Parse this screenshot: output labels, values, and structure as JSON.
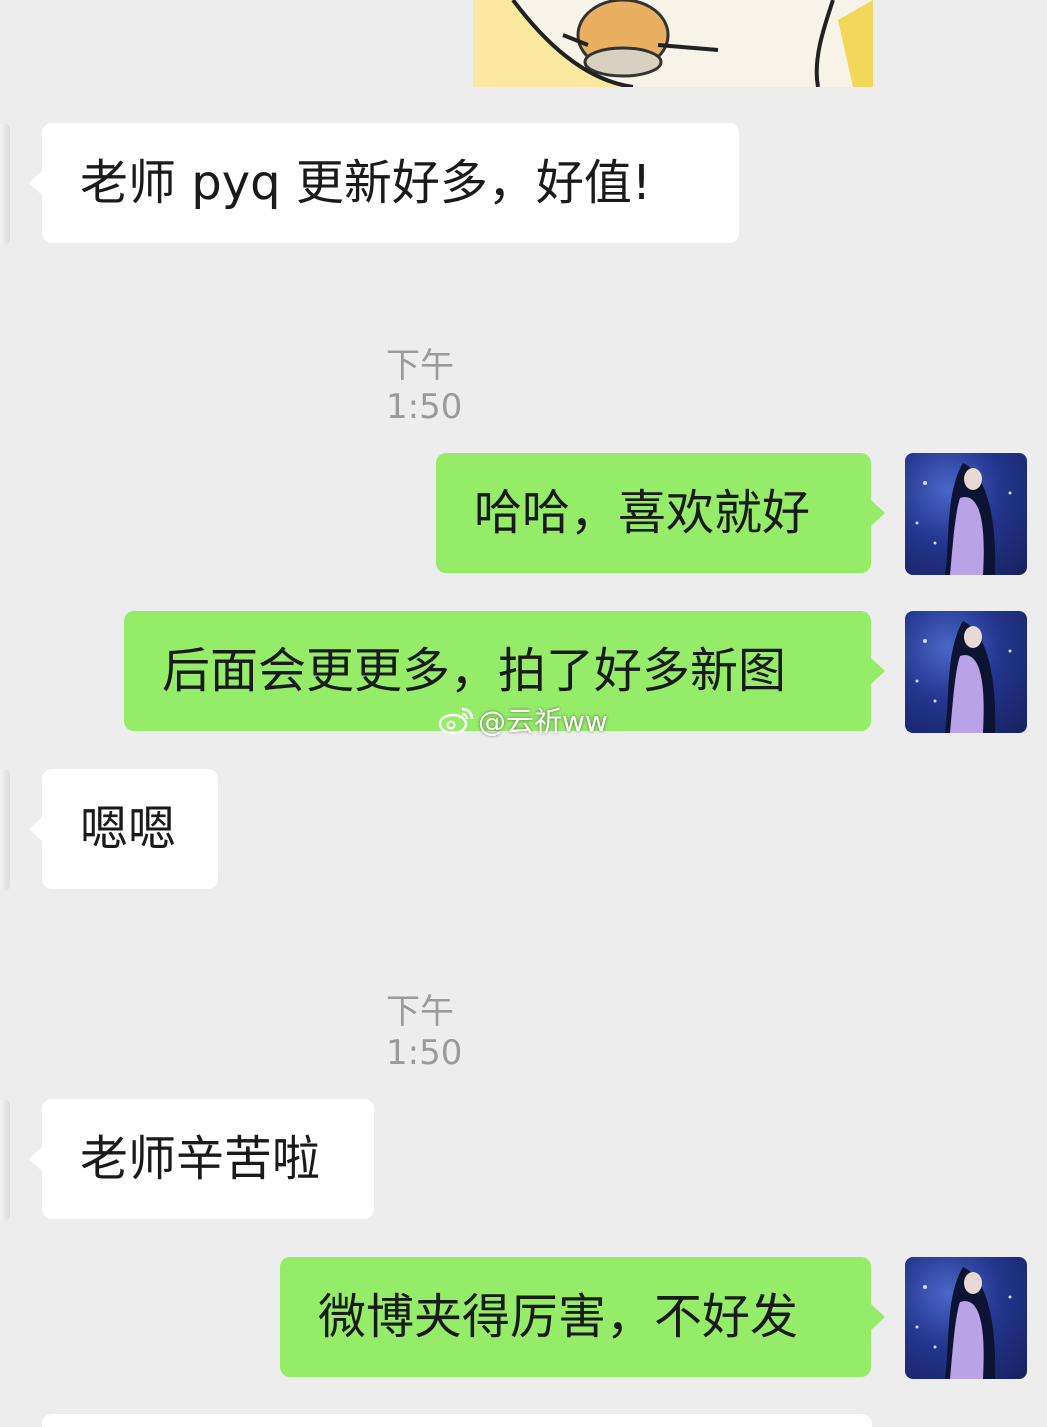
{
  "messages": [
    {
      "side": "in",
      "text": "老师 pyq 更新好多，好值!"
    },
    {
      "time": "下午1:50"
    },
    {
      "side": "out",
      "text": "哈哈，喜欢就好"
    },
    {
      "side": "out",
      "text": "后面会更更多，拍了好多新图"
    },
    {
      "side": "in",
      "text": "嗯嗯"
    },
    {
      "time": "下午1:50"
    },
    {
      "side": "in",
      "text": "老师辛苦啦"
    },
    {
      "side": "out",
      "text": "微博夹得厉害，不好发"
    }
  ],
  "watermark": {
    "handle": "@云祈ww",
    "icon": "weibo-icon"
  },
  "colors": {
    "background": "#ededed",
    "incoming_bubble": "#ffffff",
    "outgoing_bubble": "#95ec69",
    "timestamp": "#9a9a9a"
  }
}
